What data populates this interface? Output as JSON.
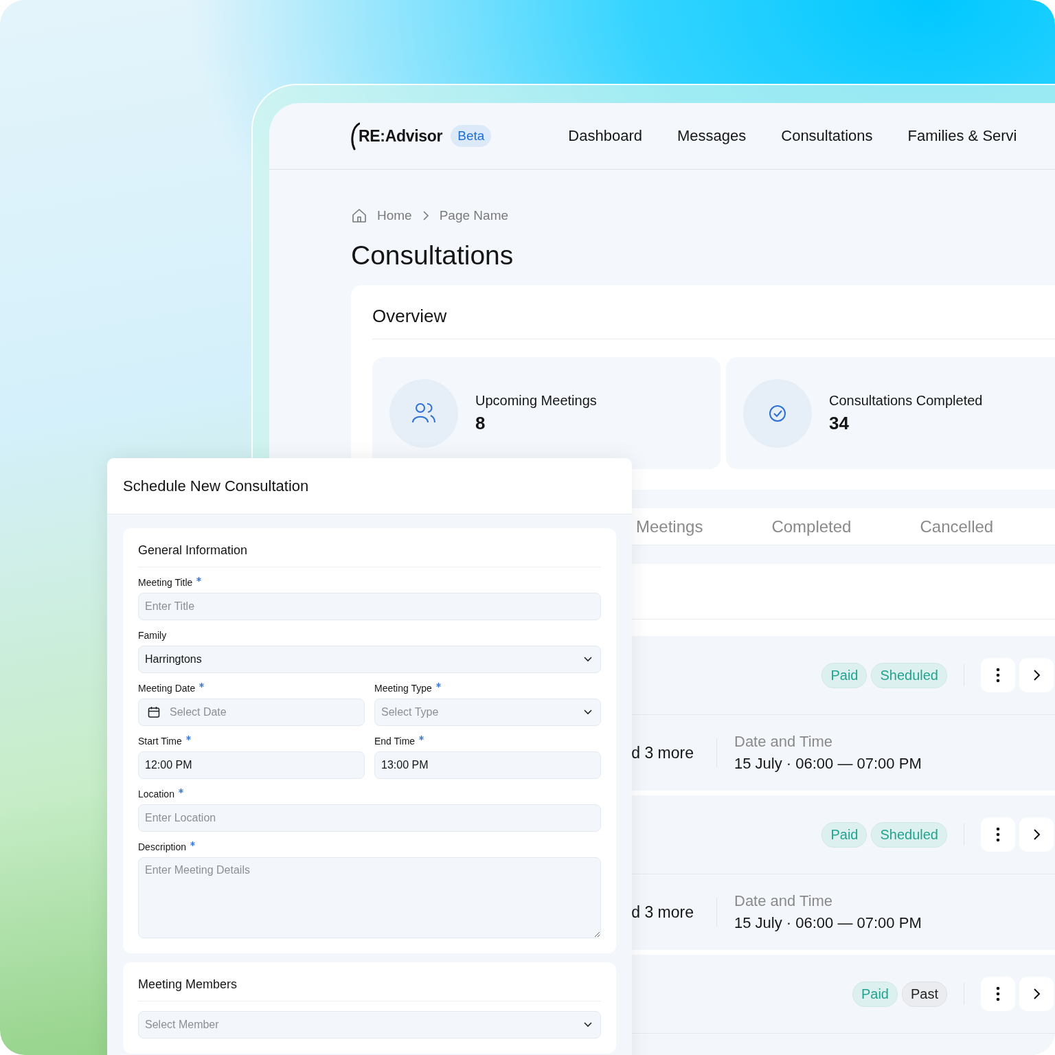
{
  "brand": {
    "logo": "RE:Advisor",
    "badge": "Beta"
  },
  "nav": [
    {
      "label": "Dashboard"
    },
    {
      "label": "Messages"
    },
    {
      "label": "Consultations"
    },
    {
      "label": "Families & Servi"
    }
  ],
  "breadcrumb": [
    "Home",
    "Page Name"
  ],
  "page_title": "Consultations",
  "overview": {
    "title": "Overview",
    "stats": [
      {
        "kind": "people",
        "label": "Upcoming Meetings",
        "value": "8"
      },
      {
        "kind": "check",
        "label": "Consultations Completed",
        "value": "34"
      }
    ]
  },
  "tabs": [
    {
      "label": "Meetings",
      "selected": false
    },
    {
      "label": "Completed",
      "selected": false
    },
    {
      "label": "Cancelled",
      "selected": false
    }
  ],
  "meetings": [
    {
      "tags": [
        {
          "label": "Paid",
          "kind": "paid"
        },
        {
          "label": "Sheduled",
          "kind": "scheduled"
        }
      ],
      "members": "d 3 more",
      "date_label": "Date and Time",
      "date": "15 July · 06:00 — 07:00 PM"
    },
    {
      "tags": [
        {
          "label": "Paid",
          "kind": "paid"
        },
        {
          "label": "Sheduled",
          "kind": "scheduled"
        }
      ],
      "members": "d 3 more",
      "date_label": "Date and Time",
      "date": "15 July · 06:00 — 07:00 PM"
    },
    {
      "tags": [
        {
          "label": "Paid",
          "kind": "paid"
        },
        {
          "label": "Past",
          "kind": "past"
        }
      ]
    }
  ],
  "dialog": {
    "title": "Schedule New Consultation",
    "sections": [
      {
        "title": "General Information",
        "rows": [
          [
            {
              "label": "Meeting Title",
              "required": true,
              "kind": "text",
              "placeholder": "Enter Title"
            }
          ],
          [
            {
              "label": "Family",
              "required": false,
              "kind": "select",
              "value": "Harringtons"
            }
          ],
          [
            {
              "label": "Meeting Date",
              "required": true,
              "kind": "date",
              "placeholder": "Select Date"
            },
            {
              "label": "Meeting Type",
              "required": true,
              "kind": "select",
              "placeholder": "Select Type"
            }
          ],
          [
            {
              "label": "Start Time",
              "required": true,
              "kind": "text",
              "value": "12:00 PM"
            },
            {
              "label": "End Time",
              "required": true,
              "kind": "text",
              "value": "13:00 PM"
            }
          ],
          [
            {
              "label": "Location",
              "required": true,
              "kind": "text",
              "placeholder": "Enter Location"
            }
          ],
          [
            {
              "label": "Description",
              "required": true,
              "kind": "textarea",
              "placeholder": "Enter Meeting Details"
            }
          ]
        ]
      },
      {
        "title": "Meeting Members",
        "rows": [
          [
            {
              "kind": "select",
              "required": false,
              "placeholder": "Select Member"
            }
          ]
        ]
      }
    ]
  }
}
